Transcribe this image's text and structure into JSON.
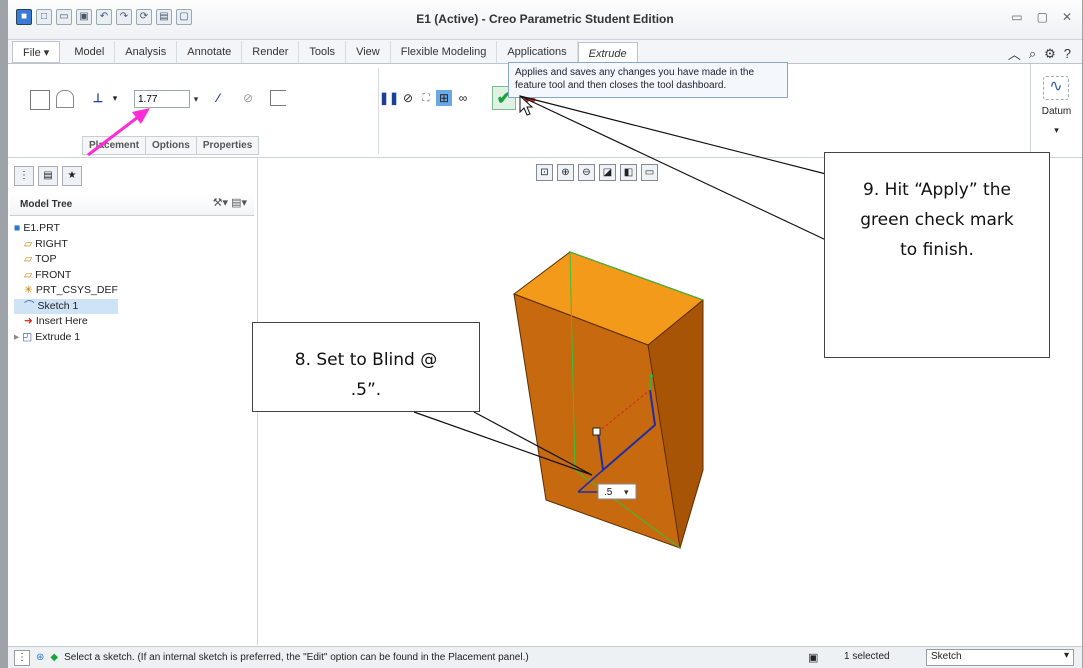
{
  "window": {
    "title": "E1 (Active) - Creo Parametric Student Edition"
  },
  "tabs": [
    "File ▾",
    "Model",
    "Analysis",
    "Annotate",
    "Render",
    "Tools",
    "View",
    "Flexible Modeling",
    "Applications",
    "Extrude"
  ],
  "active_tab": "Extrude",
  "ribbon": {
    "depth_value": "1.77",
    "subtabs": [
      "Placement",
      "Options",
      "Properties"
    ],
    "tooltip": "Applies and saves any changes you have made in the feature tool and then closes the tool dashboard.",
    "datum_label": "Datum"
  },
  "model_tree": {
    "header": "Model Tree",
    "items": [
      {
        "label": "E1.PRT",
        "level": 0
      },
      {
        "label": "RIGHT",
        "level": 1
      },
      {
        "label": "TOP",
        "level": 1
      },
      {
        "label": "FRONT",
        "level": 1
      },
      {
        "label": "PRT_CSYS_DEF",
        "level": 1
      },
      {
        "label": "Sketch 1",
        "level": 1,
        "selected": true
      },
      {
        "label": "Insert Here",
        "level": 1
      },
      {
        "label": "Extrude 1",
        "level": 1
      }
    ]
  },
  "viewport": {
    "depth_tag": ".5"
  },
  "callouts": {
    "step8": "8. Set to Blind @ .5”.",
    "step9": "9. Hit “Apply” the green check mark to finish."
  },
  "status": {
    "message": "Select a sketch. (If an internal sketch is preferred, the \"Edit\" option can be found in the Placement panel.)",
    "selected": "1 selected",
    "filter": "Sketch"
  },
  "colors": {
    "block_front": "#c76a0f",
    "block_top": "#f39a1b",
    "block_side": "#a85407",
    "arrow": "#ff2bd6",
    "check": "#1aa33a",
    "cancel": "#d6281c"
  }
}
